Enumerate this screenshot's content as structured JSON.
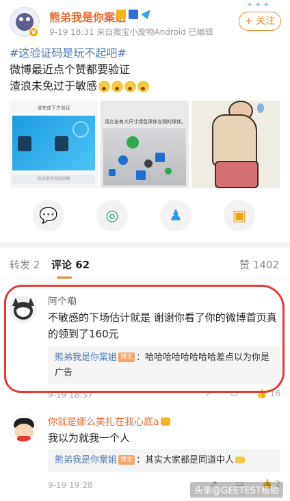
{
  "post": {
    "author": "熊弟我是你案姐",
    "meta": "9-19 18:31  来自案宝小废物Android  已编辑",
    "follow_label": "+ 关注",
    "hashtag": "#这验证码是玩不起吧#",
    "line1": "微博最近点个赞都要验证",
    "line2": "渣浪未免过于敏感",
    "images": {
      "img1_header": "请完成下方验证",
      "img1_slider": "拖动滑块完成拼图",
      "img2_header": "请点击有大尺寸绿色球体左侧的球体。"
    }
  },
  "share": {
    "icons": [
      "wechat-icon",
      "moments-icon",
      "qq-icon",
      "album-icon"
    ]
  },
  "tabs": {
    "repost": "转发 2",
    "comments": "评论 62",
    "likes": "赞 1402"
  },
  "comments": [
    {
      "name": "阿个嘞",
      "text": "不敏感的下场估计就是 谢谢你看了你的微博首页真的领到了160元",
      "reply_name": "熊弟我是你案姐",
      "reply_badge": "博主",
      "reply_text": "：哈哈哈哈哈哈哈哈差点以为你是广告",
      "time": "9-19 18:57",
      "likes": "16"
    },
    {
      "name": "你就是娜么美扎在我心底a",
      "text": "我以为就我一个人",
      "reply_name": "熊弟我是你案姐",
      "reply_badge": "博主",
      "reply_text": "：其实大家都是同道中人",
      "time": "9-19 19:28",
      "likes": "2"
    }
  ],
  "watermark": "头条@GEETEST极验",
  "colors": {
    "accent": "#f08a2c",
    "author": "#e8682f",
    "link": "#4a7ab7",
    "highlight": "#e53935"
  }
}
